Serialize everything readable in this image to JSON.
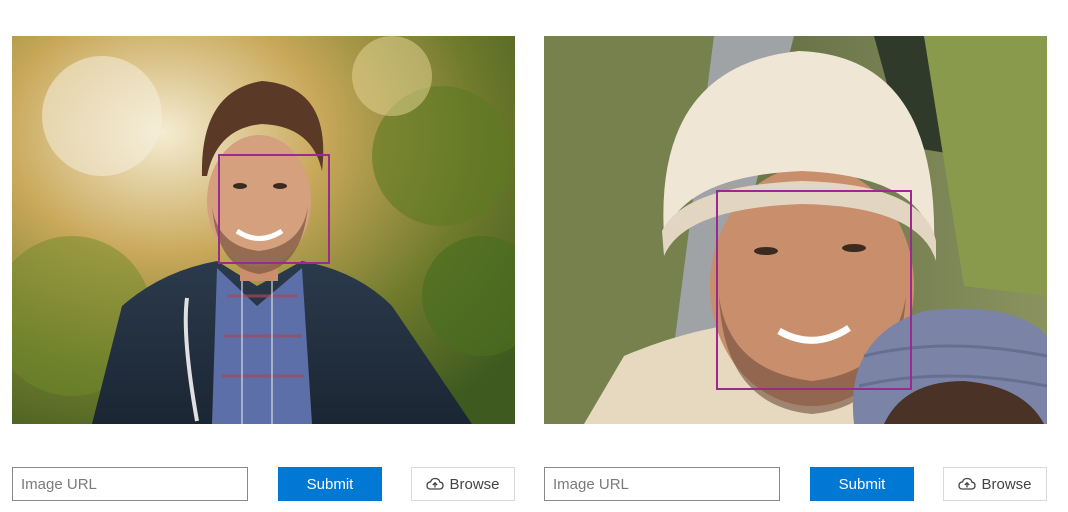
{
  "panels": [
    {
      "image": {
        "description_icon": "photo-man-outdoors"
      },
      "face_box_color": "#9b2a8f",
      "url_placeholder": "Image URL",
      "submit_label": "Submit",
      "browse_label": "Browse",
      "browse_icon": "cloud-upload-icon"
    },
    {
      "image": {
        "description_icon": "photo-man-beanie"
      },
      "face_box_color": "#9b2a8f",
      "url_placeholder": "Image URL",
      "submit_label": "Submit",
      "browse_label": "Browse",
      "browse_icon": "cloud-upload-icon"
    }
  ],
  "colors": {
    "accent": "#0078d4",
    "face_box": "#9b2a8f"
  }
}
